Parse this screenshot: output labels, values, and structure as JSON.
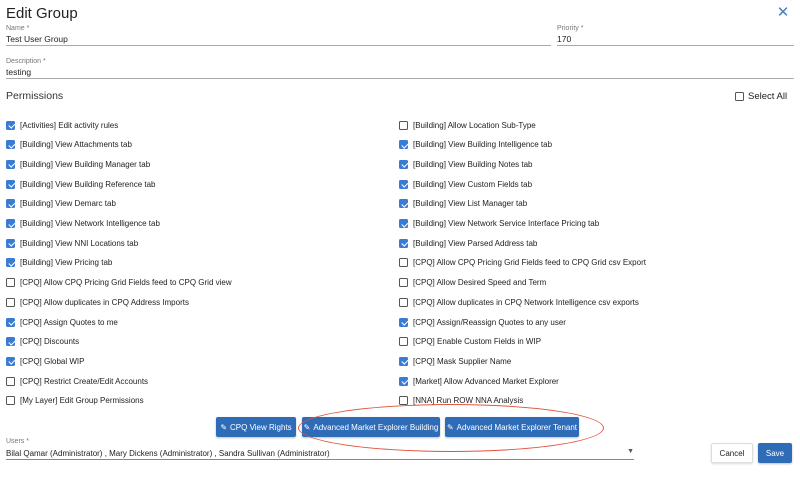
{
  "dialog": {
    "title": "Edit Group",
    "close_icon": "close-icon"
  },
  "form": {
    "name": {
      "label": "Name *",
      "value": "Test User Group"
    },
    "priority": {
      "label": "Priority *",
      "value": "170"
    },
    "description": {
      "label": "Description *",
      "value": "testing"
    }
  },
  "permissions": {
    "title": "Permissions",
    "select_all_label": "Select All",
    "select_all_checked": false,
    "left": [
      {
        "label": "[Activities] Edit activity rules",
        "checked": true
      },
      {
        "label": "[Building] View Attachments tab",
        "checked": true
      },
      {
        "label": "[Building] View Building Manager tab",
        "checked": true
      },
      {
        "label": "[Building] View Building Reference tab",
        "checked": true
      },
      {
        "label": "[Building] View Demarc tab",
        "checked": true
      },
      {
        "label": "[Building] View Network Intelligence tab",
        "checked": true
      },
      {
        "label": "[Building] View NNI Locations tab",
        "checked": true
      },
      {
        "label": "[Building] View Pricing tab",
        "checked": true
      },
      {
        "label": "[CPQ] Allow CPQ Pricing Grid Fields feed to CPQ Grid view",
        "checked": false
      },
      {
        "label": "[CPQ] Allow duplicates in CPQ Address Imports",
        "checked": false
      },
      {
        "label": "[CPQ] Assign Quotes to me",
        "checked": true
      },
      {
        "label": "[CPQ] Discounts",
        "checked": true
      },
      {
        "label": "[CPQ] Global WIP",
        "checked": true
      },
      {
        "label": "[CPQ] Restrict Create/Edit Accounts",
        "checked": false
      },
      {
        "label": "[My Layer] Edit Group Permissions",
        "checked": false
      }
    ],
    "right": [
      {
        "label": "[Building] Allow Location Sub-Type",
        "checked": false
      },
      {
        "label": "[Building] View Building Intelligence tab",
        "checked": true
      },
      {
        "label": "[Building] View Building Notes tab",
        "checked": true
      },
      {
        "label": "[Building] View Custom Fields tab",
        "checked": true
      },
      {
        "label": "[Building] View List Manager tab",
        "checked": true
      },
      {
        "label": "[Building] View Network Service Interface Pricing tab",
        "checked": true
      },
      {
        "label": "[Building] View Parsed Address tab",
        "checked": true
      },
      {
        "label": "[CPQ] Allow CPQ Pricing Grid Fields feed to CPQ Grid csv Export",
        "checked": false
      },
      {
        "label": "[CPQ] Allow Desired Speed and Term",
        "checked": false
      },
      {
        "label": "[CPQ] Allow duplicates in CPQ Network Intelligence csv exports",
        "checked": false
      },
      {
        "label": "[CPQ] Assign/Reassign Quotes to any user",
        "checked": true
      },
      {
        "label": "[CPQ] Enable Custom Fields in WIP",
        "checked": false
      },
      {
        "label": "[CPQ] Mask Supplier Name",
        "checked": true
      },
      {
        "label": "[Market] Allow Advanced Market Explorer",
        "checked": true
      },
      {
        "label": "[NNA] Run ROW NNA Analysis",
        "checked": false
      }
    ]
  },
  "actions": {
    "cpq_view_rights": "CPQ View Rights",
    "ame_building": "Advanced Market Explorer Building",
    "ame_tenant": "Advanced Market Explorer Tenant",
    "pencil_icon": "pencil-icon"
  },
  "users": {
    "label": "Users *",
    "value": "Bilal Qamar (Administrator) , Mary Dickens (Administrator) , Sandra Sullivan (Administrator)"
  },
  "footer": {
    "cancel": "Cancel",
    "save": "Save"
  },
  "colors": {
    "accent": "#2e6cb8",
    "checkbox": "#3a7bd5",
    "highlight": "#e0543e"
  }
}
